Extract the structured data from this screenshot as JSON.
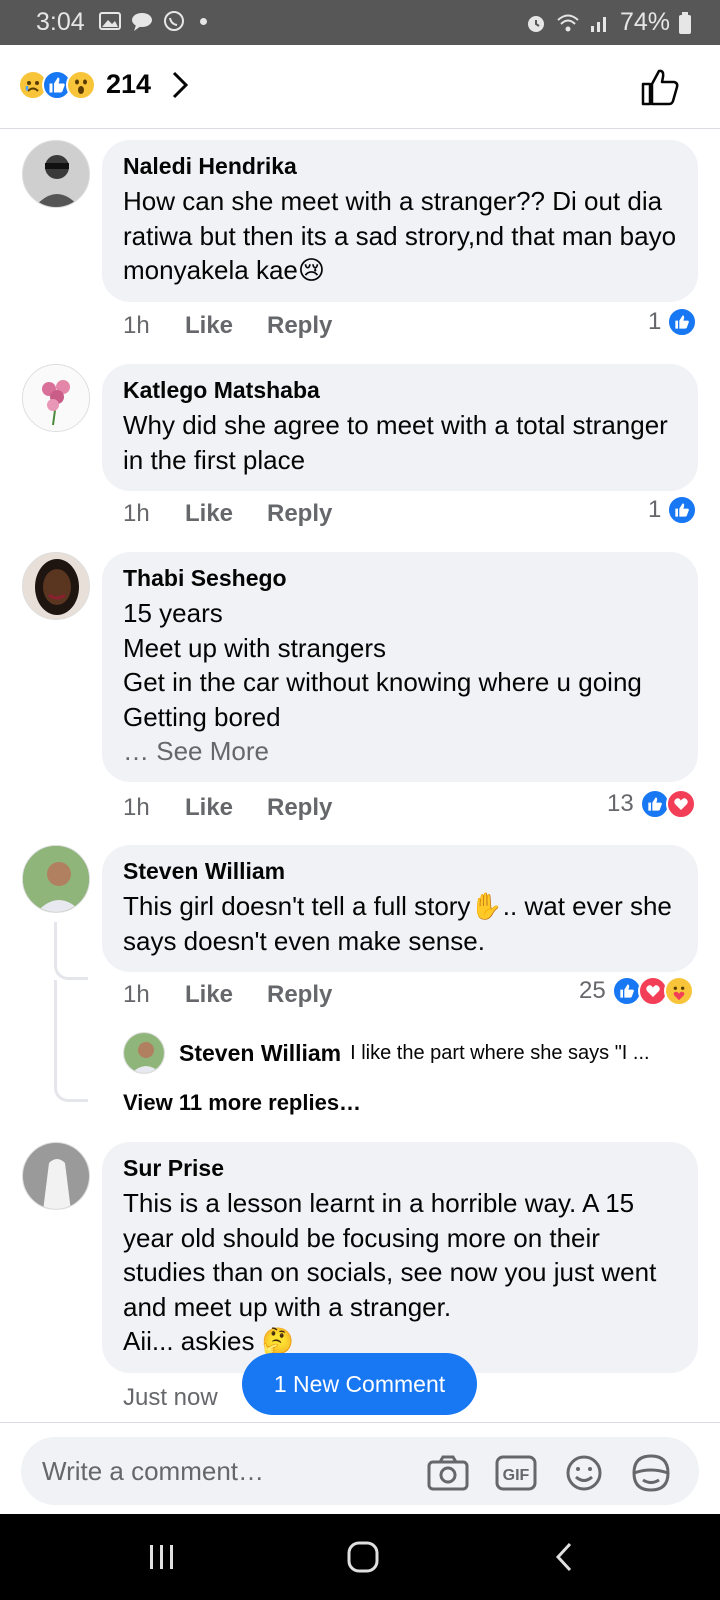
{
  "status_bar": {
    "time": "3:04",
    "battery": "74%"
  },
  "header": {
    "reaction_count": "214"
  },
  "comments": [
    {
      "author": "Naledi Hendrika",
      "text": "How can she meet with a stranger?? Di out dia ratiwa but then its a sad strory,nd that man bayo monyakela kae😢",
      "time": "1h",
      "like_label": "Like",
      "reply_label": "Reply",
      "reactions": "1"
    },
    {
      "author": "Katlego Matshaba",
      "text": "Why did she agree to meet with a total stranger in the first place",
      "time": "1h",
      "like_label": "Like",
      "reply_label": "Reply",
      "reactions": "1"
    },
    {
      "author": "Thabi Seshego",
      "text": "15 years\nMeet up with strangers\nGet in the car without knowing where u going\nGetting bored",
      "see_more": "… See More",
      "time": "1h",
      "like_label": "Like",
      "reply_label": "Reply",
      "reactions": "13"
    },
    {
      "author": "Steven William",
      "text": "This girl doesn't tell a full story✋.. wat ever she says doesn't even make sense.",
      "time": "1h",
      "like_label": "Like",
      "reply_label": "Reply",
      "reactions": "25",
      "reply_preview": {
        "author": "Steven William",
        "text": "I like the part where she says \"I ..."
      },
      "more_replies": "View 11 more replies…"
    },
    {
      "author": "Sur Prise",
      "text": "This is a lesson learnt in a horrible way. A 15 year old should be focusing more on their studies than on socials, see now you just went and meet up with a stranger.\nAii... askies 🤔",
      "time": "Just now"
    }
  ],
  "new_comment_label": "1 New Comment",
  "composer": {
    "placeholder": "Write a comment…",
    "gif_label": "GIF"
  },
  "icons": [
    "picture-icon",
    "chat-icon",
    "whatsapp-icon",
    "alarm-icon",
    "wifi-icon",
    "signal-icon",
    "battery-icon",
    "sad-reaction-icon",
    "like-reaction-icon",
    "wow-reaction-icon",
    "chevron-right-icon",
    "thumbs-up-icon",
    "camera-icon",
    "gif-icon",
    "emoji-icon",
    "sticker-icon",
    "recents-icon",
    "home-icon",
    "back-icon"
  ],
  "colors": {
    "accent": "#1877f2",
    "bubble": "#f0f2f5",
    "secondary_text": "#65676b",
    "love": "#f33e58"
  }
}
